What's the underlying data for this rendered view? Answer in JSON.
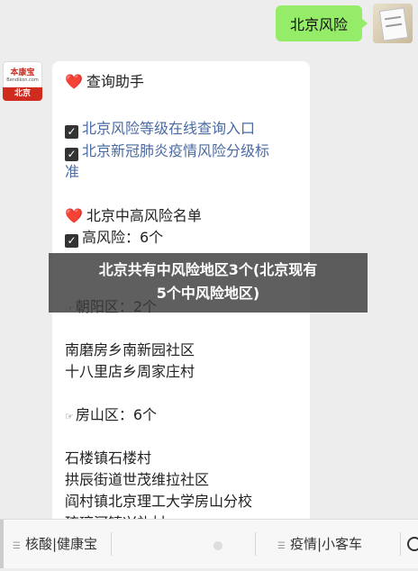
{
  "user_message": "北京风险",
  "bot": {
    "brand": "本康宝",
    "domain": "Bendikon.com",
    "city": "北京"
  },
  "content": {
    "heart1": "❤️",
    "title1": "查询助手",
    "link1": "北京风险等级在线查询入口",
    "link2a": "北京新冠肺炎疫情风险分级标",
    "link2b": "准",
    "heart2": "❤️",
    "title2": "北京中高风险名单",
    "hidden_line": "高风险：6个",
    "district1": "朝阳区：2个",
    "d1_item1": "南磨房乡南新园社区",
    "d1_item2": "十八里店乡周家庄村",
    "district2": "房山区：6个",
    "d2_item1": "石楼镇石楼村",
    "d2_item2": "拱辰街道世茂维拉社区",
    "d2_item3": "阎村镇北京理工大学房山分校",
    "d2_item4": "琉璃河镇兴礼村"
  },
  "overlay": {
    "line1": "北京共有中风险地区3个(北京现有",
    "line2": "5个中风险地区)"
  },
  "menu": {
    "item1": "核酸|健康宝",
    "item2": "疫情|小客车"
  },
  "colors": {
    "user_bubble": "#95ec69",
    "link": "#4a6aa3",
    "background": "#ededed"
  }
}
